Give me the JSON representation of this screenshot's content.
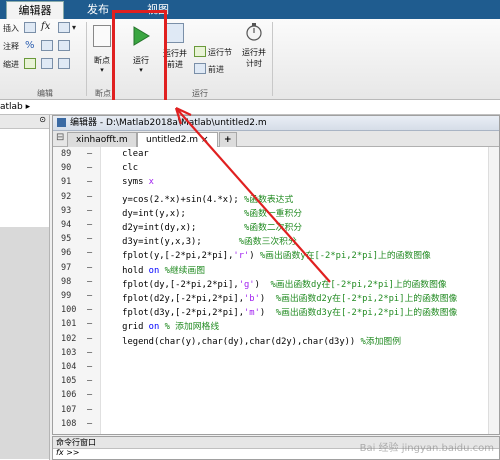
{
  "ribbon_tabs": [
    "编辑器",
    "发布",
    "视图"
  ],
  "ribbon": {
    "edit_group": {
      "insert": "插入",
      "comment": "注释",
      "indent": "缩进",
      "fx": "fx",
      "percent": "%",
      "label": "编辑"
    },
    "breakpoint": {
      "label": "断点",
      "group_label": "断点"
    },
    "run": {
      "label": "运行",
      "group_label": "运行"
    },
    "run_advance": {
      "line1": "运行并",
      "line2": "前进"
    },
    "run_section": "运行节",
    "advance": "前进",
    "run_time": {
      "line1": "运行并",
      "line2": "计时"
    }
  },
  "path": "atlab ▸",
  "editor": {
    "title": "编辑器 - D:\\Matlab2018a\\Matlab\\untitled2.m",
    "tabs": [
      "xinhaofft.m",
      "untitled2.m",
      "+"
    ],
    "lines": [
      {
        "n": "89",
        "code": [
          {
            "t": "    clear",
            "c": ""
          }
        ]
      },
      {
        "n": "90",
        "code": [
          {
            "t": "    clc",
            "c": ""
          }
        ]
      },
      {
        "n": "91",
        "code": [
          {
            "t": "    syms ",
            "c": ""
          },
          {
            "t": "x",
            "c": "str"
          }
        ]
      },
      {
        "n": "92",
        "code": [
          {
            "t": "    y=cos(2.*x)+sin(4.*x); ",
            "c": ""
          },
          {
            "t": "%函数表达式",
            "c": "cm"
          }
        ]
      },
      {
        "n": "93",
        "code": [
          {
            "t": "    dy=int(y,x);           ",
            "c": ""
          },
          {
            "t": "%函数一重积分",
            "c": "cm"
          }
        ]
      },
      {
        "n": "94",
        "code": [
          {
            "t": "    d2y=int(dy,x);         ",
            "c": ""
          },
          {
            "t": "%函数二次积分",
            "c": "cm"
          }
        ]
      },
      {
        "n": "95",
        "code": [
          {
            "t": "    d3y=int(y,x,3);       ",
            "c": ""
          },
          {
            "t": "%函数三次积分",
            "c": "cm"
          }
        ]
      },
      {
        "n": "96",
        "code": [
          {
            "t": "    fplot(y,[-2*pi,2*pi],",
            "c": ""
          },
          {
            "t": "'r'",
            "c": "str"
          },
          {
            "t": ") ",
            "c": ""
          },
          {
            "t": "%画出函数y在[-2*pi,2*pi]上的函数图像",
            "c": "cm"
          }
        ]
      },
      {
        "n": "97",
        "code": [
          {
            "t": "    hold ",
            "c": ""
          },
          {
            "t": "on",
            "c": "kw"
          },
          {
            "t": " ",
            "c": ""
          },
          {
            "t": "%继续画图",
            "c": "cm"
          }
        ]
      },
      {
        "n": "98",
        "code": [
          {
            "t": "    fplot(dy,[-2*pi,2*pi],",
            "c": ""
          },
          {
            "t": "'g'",
            "c": "str"
          },
          {
            "t": ")  ",
            "c": ""
          },
          {
            "t": "%画出函数dy在[-2*pi,2*pi]上的函数图像",
            "c": "cm"
          }
        ]
      },
      {
        "n": "99",
        "code": [
          {
            "t": "    fplot(d2y,[-2*pi,2*pi],",
            "c": ""
          },
          {
            "t": "'b'",
            "c": "str"
          },
          {
            "t": ")  ",
            "c": ""
          },
          {
            "t": "%画出函数d2y在[-2*pi,2*pi]上的函数图像",
            "c": "cm"
          }
        ]
      },
      {
        "n": "100",
        "code": [
          {
            "t": "    fplot(d3y,[-2*pi,2*pi],",
            "c": ""
          },
          {
            "t": "'m'",
            "c": "str"
          },
          {
            "t": ")  ",
            "c": ""
          },
          {
            "t": "%画出函数d3y在[-2*pi,2*pi]上的函数图像",
            "c": "cm"
          }
        ]
      },
      {
        "n": "101",
        "code": [
          {
            "t": "    grid ",
            "c": ""
          },
          {
            "t": "on",
            "c": "kw"
          },
          {
            "t": " ",
            "c": ""
          },
          {
            "t": "% 添加网格线",
            "c": "cm"
          }
        ]
      },
      {
        "n": "102",
        "code": [
          {
            "t": "    legend(char(y),char(dy),char(d2y),char(d3y)) ",
            "c": ""
          },
          {
            "t": "%添加图例",
            "c": "cm"
          }
        ]
      },
      {
        "n": "103",
        "code": []
      },
      {
        "n": "104",
        "code": []
      },
      {
        "n": "105",
        "code": []
      },
      {
        "n": "106",
        "code": []
      },
      {
        "n": "107",
        "code": []
      },
      {
        "n": "108",
        "code": []
      }
    ]
  },
  "command_window": {
    "title": "命令行窗口",
    "prompt": "fx >>"
  },
  "watermark": "Bai 经验 jingyan.baidu.com",
  "colors": {
    "highlight": "#e02020",
    "keyword": "#0000ff",
    "string": "#a020f0",
    "comment": "#228b22"
  }
}
